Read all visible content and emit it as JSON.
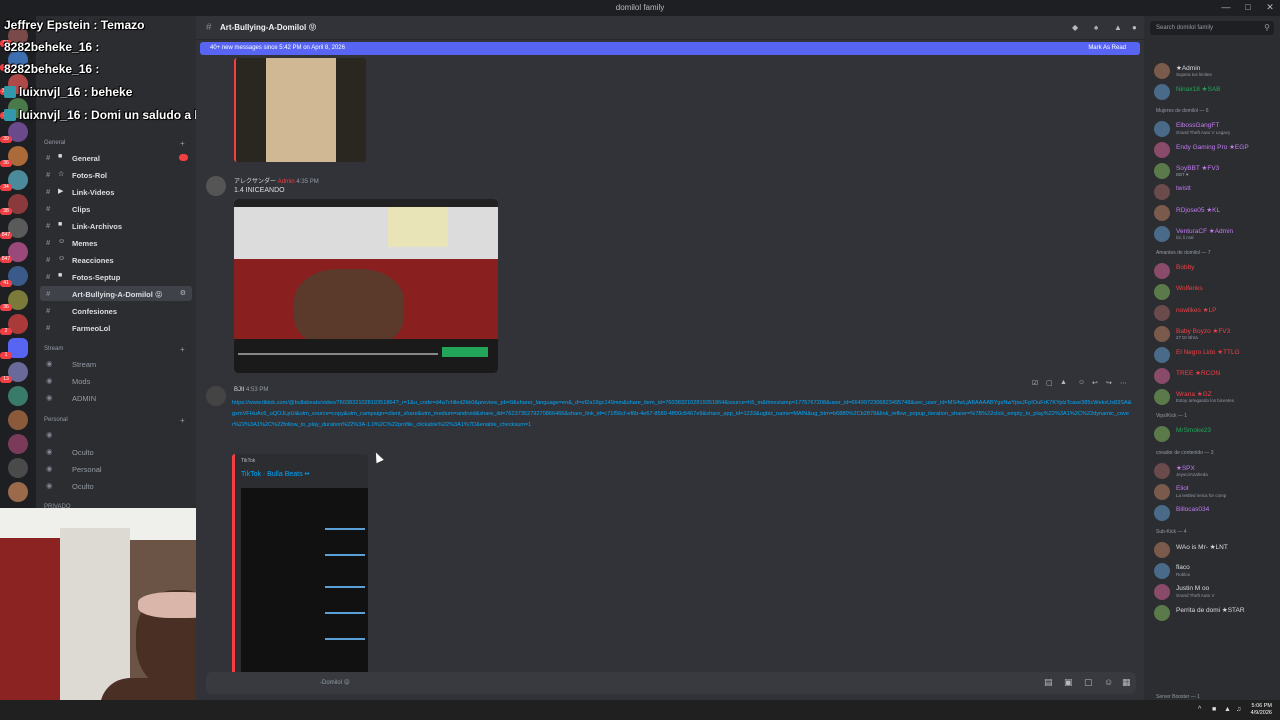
{
  "window": {
    "title": "domilol family"
  },
  "stream_overlay": [
    {
      "text": "Jeffrey Epstein : Temazo"
    },
    {
      "text": "8282beheke_16 :"
    },
    {
      "text": "8282beheke_16 :"
    },
    {
      "text": "luixnvjl_16 : beheke"
    },
    {
      "text": "luixnvjl_16 : Domi un saludo a kennygalindo"
    }
  ],
  "server_badges": [
    "91",
    "2",
    "360",
    "27",
    "39",
    "36",
    "34",
    "38",
    "847",
    "847",
    "41",
    "36",
    "2",
    "1",
    "13"
  ],
  "channels": {
    "category_general": "General",
    "items": [
      {
        "emoji": "■",
        "label": "General",
        "unread": true
      },
      {
        "emoji": "☆",
        "label": "Fotos-Rol"
      },
      {
        "emoji": "▶",
        "label": "Link-Videos"
      },
      {
        "emoji": "",
        "label": "Clips"
      },
      {
        "emoji": "■",
        "label": "Link-Archivos"
      },
      {
        "emoji": "☺",
        "label": "Memes"
      },
      {
        "emoji": "☺",
        "label": "Reacciones"
      },
      {
        "emoji": "■",
        "label": "Fotos-Septup"
      },
      {
        "emoji": "",
        "label": "Art-Bullying-A-Domilol 😝",
        "selected": true
      },
      {
        "emoji": "",
        "label": "Confesiones"
      },
      {
        "emoji": "",
        "label": "FarmeoLol"
      }
    ],
    "category_stream": "Stream",
    "stream_items": [
      {
        "label": "Stream"
      },
      {
        "label": "Mods"
      },
      {
        "label": "ADMIN"
      }
    ],
    "category_personal": "Personal",
    "personal_items": [
      {
        "label": ""
      },
      {
        "label": "Oculto"
      },
      {
        "label": "Personal"
      },
      {
        "label": "Oculto"
      }
    ],
    "category_privado": "PRIVADO"
  },
  "chat": {
    "channel_name": "Art-Bullying-A-Domilol 😝",
    "new_messages_banner": "40+ new messages since 5:42 PM on April 8, 2026",
    "mark_as_read": "Mark As Read",
    "messages": [
      {
        "author": "アレクサンダー",
        "role": "Admin",
        "time": "4:35 PM",
        "text": "1.4 INICEANDO"
      },
      {
        "author": "BJII",
        "time": "4:53 PM",
        "link": "https://www.tiktok.com/@bullabeats/video/7603832102819351864?_r=1&u_code=d4a7chlled2kk0&preview_pb=0&sharer_language=en&_d=ef2a19gc149mm&share_item_id=7603832102819351864&source=h5_m&timestamp=1775767208&user_id=6649972306823495748&sec_user_id=MS4wLjABAAAABYgsNwYpwJFpIOuFrK7KYplzTcase385cWekxUs83SA&gsmVFHuAc6_uQOJLpUi&utm_source=copy&utm_campaign=client_share&utm_medium=android&share_iid=7623735279270866466&share_link_id=c71f56cf-ef6b-4e67-8580-4ff00c6467e9&share_app_id=1233&ugbiz_name=MAIN&ug_btm=b6880%2Cb2878&link_reflow_popup_iteration_sharer=%7B%22click_empty_to_play%22%3A1%2C%22dynamic_cover%22%3A1%2C%22follow_to_play_duration%22%3A-1.0%2C%22profile_clickable%22%3A1%7D&enable_checksum=1",
        "embed_provider": "TikTok",
        "embed_title": "TikTok · Bulla Beats ••"
      }
    ],
    "composer_placeholder": "-Domilol 😝"
  },
  "members": {
    "search_placeholder": "Search domilol family",
    "groups": [
      {
        "title": "",
        "members": [
          {
            "name": "★Admin",
            "sub": "Supera tus limites",
            "color": "#dbdee1"
          },
          {
            "name": "Ninax18 ★SAB",
            "sub": "",
            "color": "#23a55a"
          }
        ]
      },
      {
        "title": "Mujeres de domilol — 6",
        "members": [
          {
            "name": "ElbossGangFT",
            "sub": "Grand Theft Auto V Legacy",
            "color": "#c37bf0"
          },
          {
            "name": "Endy Gaming Pro ★EGP",
            "sub": "",
            "color": "#c37bf0"
          },
          {
            "name": "SoyBBT ★FV3",
            "sub": "BBT ♥",
            "color": "#c37bf0"
          },
          {
            "name": "twistt",
            "sub": "",
            "color": "#c37bf0"
          },
          {
            "name": "RDjose05 ★KL",
            "sub": "",
            "color": "#c37bf0"
          },
          {
            "name": "VenturaCF ★Admin",
            "sub": "lol, li mal",
            "color": "#c37bf0"
          }
        ]
      },
      {
        "title": "Amantes de domilol — 7",
        "members": [
          {
            "name": "Bobby",
            "sub": "",
            "color": "#f23f43"
          },
          {
            "name": "Wolfenks",
            "sub": "",
            "color": "#f23f43"
          },
          {
            "name": "nowlikes ★LP",
            "sub": "",
            "color": "#f23f43"
          },
          {
            "name": "Baby Boyzo ★FV3",
            "sub": "27 Dr Bhra",
            "color": "#f23f43"
          },
          {
            "name": "El Negro Lido ★TTLG",
            "sub": "",
            "color": "#f23f43"
          },
          {
            "name": "TREE ★RCON",
            "sub": "",
            "color": "#f23f43"
          },
          {
            "name": "Wrana ★GZ",
            "sub": "Estoy arregando los bicentes",
            "color": "#f23f43"
          }
        ]
      },
      {
        "title": "Vips/Kick — 1",
        "members": [
          {
            "name": "MrSmoke23",
            "sub": "",
            "color": "#23a55a"
          }
        ]
      },
      {
        "title": "creador de contenido — 3",
        "members": [
          {
            "name": "★SPX",
            "sub": "JeyscriAzaheda",
            "color": "#c37bf0"
          },
          {
            "name": "Eliot",
            "sub": "La testled neica for comp",
            "color": "#c37bf0"
          },
          {
            "name": "Billocas034",
            "sub": "",
            "color": "#c37bf0"
          }
        ]
      },
      {
        "title": "Sub-Kick — 4",
        "members": [
          {
            "name": "WAo is Mr- ★LNT",
            "sub": "",
            "color": "#dbdee1"
          },
          {
            "name": "flaco",
            "sub": "Roblox",
            "color": "#dbdee1"
          },
          {
            "name": "Justin M oo",
            "sub": "Grand Theft Auto V",
            "color": "#dbdee1"
          },
          {
            "name": "Perrita de domi ★STAR",
            "sub": "",
            "color": "#dbdee1"
          }
        ]
      }
    ],
    "footer_group": "Server Booster — 1"
  },
  "taskbar": {
    "time": "5:06 PM",
    "date": "4/9/2026"
  },
  "colors": {
    "accent": "#5865f2",
    "link": "#00a8fc",
    "danger": "#f23f43",
    "online": "#23a55a"
  }
}
